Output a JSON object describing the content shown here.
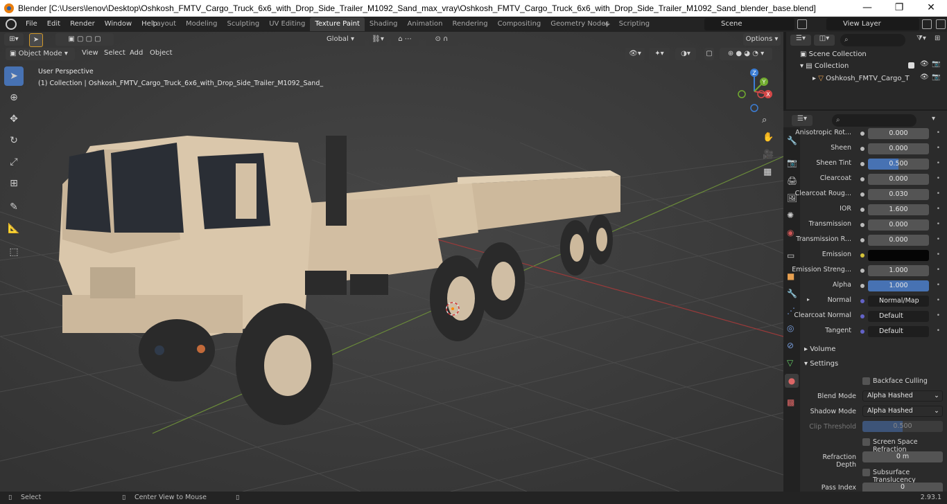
{
  "window": {
    "title": "Blender [C:\\Users\\lenov\\Desktop\\Oshkosh_FMTV_Cargo_Truck_6x6_with_Drop_Side_Trailer_M1092_Sand_max_vray\\Oshkosh_FMTV_Cargo_Truck_6x6_with_Drop_Side_Trailer_M1092_Sand_blender_base.blend]",
    "minimize": "—",
    "maximize": "❐",
    "close": "✕"
  },
  "menu": {
    "file": "File",
    "edit": "Edit",
    "render": "Render",
    "window": "Window",
    "help": "Help"
  },
  "workspaces": [
    "Layout",
    "Modeling",
    "Sculpting",
    "UV Editing",
    "Texture Paint",
    "Shading",
    "Animation",
    "Rendering",
    "Compositing",
    "Geometry Nodes",
    "Scripting"
  ],
  "active_workspace": "Texture Paint",
  "scene": {
    "name": "Scene",
    "view_layer": "View Layer"
  },
  "viewport": {
    "transform_orientation": "Global",
    "options": "Options",
    "mode": "Object Mode",
    "header_menus": {
      "view": "View",
      "select": "Select",
      "add": "Add",
      "object": "Object"
    },
    "perspective_label": "User Perspective",
    "collection_label": "(1) Collection | Oshkosh_FMTV_Cargo_Truck_6x6_with_Drop_Side_Trailer_M1092_Sand_",
    "gizmo": {
      "x": "X",
      "y": "Y",
      "z": "Z"
    }
  },
  "outliner": {
    "scene_collection": "Scene Collection",
    "collection": "Collection",
    "object": "Oshkosh_FMTV_Cargo_T"
  },
  "properties": {
    "rows": [
      {
        "label": "Anisotropic Rot...",
        "value": "0.000",
        "style": "num"
      },
      {
        "label": "Sheen",
        "value": "0.000",
        "style": "num"
      },
      {
        "label": "Sheen Tint",
        "value": "0.500",
        "style": "blue"
      },
      {
        "label": "Clearcoat",
        "value": "0.000",
        "style": "num"
      },
      {
        "label": "Clearcoat Roug...",
        "value": "0.030",
        "style": "num"
      },
      {
        "label": "IOR",
        "value": "1.600",
        "style": "num"
      },
      {
        "label": "Transmission",
        "value": "0.000",
        "style": "num"
      },
      {
        "label": "Transmission R...",
        "value": "0.000",
        "style": "num"
      },
      {
        "label": "Emission",
        "value": "",
        "style": "black"
      },
      {
        "label": "Emission Streng...",
        "value": "1.000",
        "style": "num"
      },
      {
        "label": "Alpha",
        "value": "1.000",
        "style": "blue"
      },
      {
        "label": "Normal",
        "value": "Normal/Map",
        "style": "link"
      },
      {
        "label": "Clearcoat Normal",
        "value": "Default",
        "style": "link"
      },
      {
        "label": "Tangent",
        "value": "Default",
        "style": "link"
      }
    ],
    "volume": "Volume",
    "settings": "Settings",
    "backface_culling": "Backface Culling",
    "blend_mode_label": "Blend Mode",
    "blend_mode": "Alpha Hashed",
    "shadow_mode_label": "Shadow Mode",
    "shadow_mode": "Alpha Hashed",
    "clip_threshold_label": "Clip Threshold",
    "clip_threshold": "0.500",
    "screen_space_refraction": "Screen Space Refraction",
    "refraction_depth_label": "Refraction Depth",
    "refraction_depth": "0 m",
    "subsurface_translucency": "Subsurface Translucency",
    "pass_index_label": "Pass Index",
    "pass_index": "0"
  },
  "status": {
    "select": "Select",
    "center_view": "Center View to Mouse",
    "version": "2.93.1"
  },
  "colors": {
    "accent": "#4772b3",
    "truck": "#d8c4a8",
    "background": "#3d3d3d"
  }
}
